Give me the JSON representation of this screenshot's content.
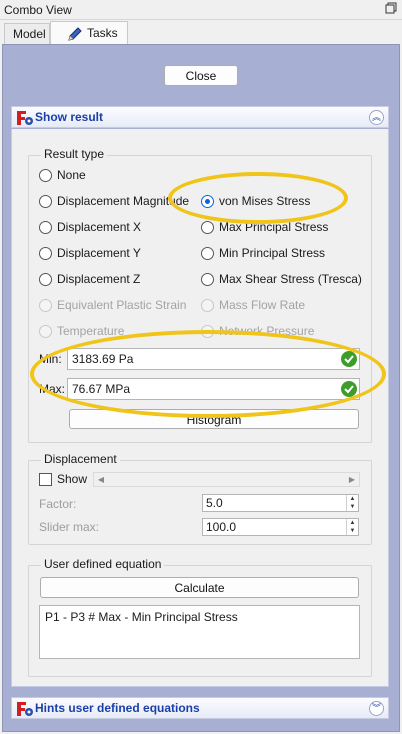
{
  "window": {
    "title": "Combo View"
  },
  "tabs": [
    {
      "label": "Model"
    },
    {
      "label": "Tasks"
    }
  ],
  "close_label": "Close",
  "show_result": {
    "header": "Show result",
    "result_type": {
      "title": "Result type",
      "options": [
        {
          "label": "None"
        },
        {
          "label": "Displacement Magnitude"
        },
        {
          "label": "von Mises Stress"
        },
        {
          "label": "Displacement X"
        },
        {
          "label": "Max Principal Stress"
        },
        {
          "label": "Displacement Y"
        },
        {
          "label": "Min Principal Stress"
        },
        {
          "label": "Displacement Z"
        },
        {
          "label": "Max Shear Stress (Tresca)"
        },
        {
          "label": "Equivalent Plastic Strain"
        },
        {
          "label": "Mass Flow Rate"
        },
        {
          "label": "Temperature"
        },
        {
          "label": "Network Pressure"
        }
      ],
      "selected": "von Mises Stress",
      "min_label": "Min:",
      "min_value": "3183.69 Pa",
      "max_label": "Max:",
      "max_value": "76.67 MPa",
      "histogram_label": "Histogram"
    },
    "displacement": {
      "title": "Displacement",
      "show_label": "Show",
      "factor_label": "Factor:",
      "factor_value": "5.0",
      "slider_max_label": "Slider max:",
      "slider_max_value": "100.0"
    },
    "user_equation": {
      "title": "User defined equation",
      "calculate_label": "Calculate",
      "equation": "P1 - P3 # Max - Min Principal Stress"
    }
  },
  "hints": {
    "header": "Hints user defined equations"
  },
  "colors": {
    "panel": "#a7b0d3",
    "header_text": "#1b3fa8",
    "highlight": "#f0c419"
  }
}
